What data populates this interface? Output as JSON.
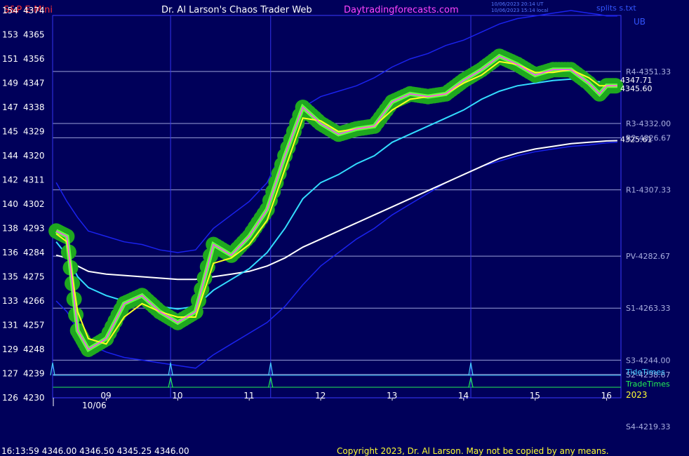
{
  "header": {
    "symbol": "S&P E-Mini",
    "title": "Dr. Al Larson's Chaos Trader Web",
    "site": "Daytradingforecasts.com",
    "timestamp_utc": "10/06/2023 20:14 UT",
    "timestamp_local": "10/06/2023 15:14 local",
    "split": "splits s.txt",
    "ub": "UB"
  },
  "footer": {
    "last_bar": "16:13:59  4346.00 4346.50 4345.25 4346.00",
    "copyright": "Copyright 2023, Dr. Al Larson. May not be copied by any means."
  },
  "colors": {
    "background": "#00005a",
    "frame": "#3a3aff",
    "price_cloud": "#1fa81f",
    "price_core": "#66ff44",
    "yellow_avg": "#ffff22",
    "magenta_avg": "#ff44ff",
    "cyan_avg": "#33ddff",
    "white_avg": "#ffffff",
    "band": "#1a22ee",
    "pivot_line": "#9aa0d8",
    "tide_spike": "#44ccff",
    "trade_spike": "#22ee55",
    "symbol_red": "#ff3333",
    "site_magenta": "#ff44ff"
  },
  "chart_data": {
    "type": "line",
    "date_label": "10/06",
    "year_label": "2023",
    "x_hours": [
      "09",
      "10",
      "11",
      "12",
      "13",
      "14",
      "15",
      "16"
    ],
    "y_axis": {
      "range": [
        4230,
        4374
      ],
      "levels": [
        {
          "pts": "154",
          "price": "4374"
        },
        {
          "pts": "153",
          "price": "4365"
        },
        {
          "pts": "151",
          "price": "4356"
        },
        {
          "pts": "149",
          "price": "4347"
        },
        {
          "pts": "147",
          "price": "4338"
        },
        {
          "pts": "145",
          "price": "4329"
        },
        {
          "pts": "144",
          "price": "4320"
        },
        {
          "pts": "142",
          "price": "4311"
        },
        {
          "pts": "140",
          "price": "4302"
        },
        {
          "pts": "138",
          "price": "4293"
        },
        {
          "pts": "136",
          "price": "4284"
        },
        {
          "pts": "135",
          "price": "4275"
        },
        {
          "pts": "133",
          "price": "4266"
        },
        {
          "pts": "131",
          "price": "4257"
        },
        {
          "pts": "129",
          "price": "4248"
        },
        {
          "pts": "127",
          "price": "4239"
        },
        {
          "pts": "126",
          "price": "4230"
        }
      ]
    },
    "pivots": [
      {
        "label": "R4-4351.33",
        "value": 4351.33
      },
      {
        "label": "R3-4332.00",
        "value": 4332.0
      },
      {
        "label": "R2-4326.67",
        "value": 4326.67
      },
      {
        "label": "R1-4307.33",
        "value": 4307.33
      },
      {
        "label": "PV-4282.67",
        "value": 4282.67
      },
      {
        "label": "S1-4263.33",
        "value": 4263.33
      },
      {
        "label": "S3-4244.00",
        "value": 4244.0
      },
      {
        "label": "S2-4238.67",
        "value": 4238.67
      },
      {
        "label": "S4-4219.33",
        "value": 4219.33
      }
    ],
    "right_values": [
      {
        "label": "4347.71",
        "value": 4347.71
      },
      {
        "label": "4345.60",
        "value": 4345.6
      },
      {
        "label": "4325.61",
        "value": 4325.61
      }
    ],
    "series_time_hours": [
      8.3,
      8.45,
      8.6,
      8.75,
      9.0,
      9.25,
      9.5,
      9.75,
      10.0,
      10.25,
      10.5,
      10.75,
      11.0,
      11.25,
      11.5,
      11.75,
      12.0,
      12.25,
      12.5,
      12.75,
      13.0,
      13.25,
      13.5,
      13.75,
      14.0,
      14.25,
      14.5,
      14.75,
      15.0,
      15.25,
      15.5,
      15.75,
      15.9,
      16.0,
      16.15
    ],
    "series": [
      {
        "name": "price",
        "values": [
          4292,
          4290,
          4255,
          4248,
          4252,
          4265,
          4268,
          4262,
          4258,
          4262,
          4287,
          4283,
          4290,
          4300,
          4320,
          4338,
          4332,
          4328,
          4330,
          4331,
          4340,
          4343,
          4342,
          4343,
          4348,
          4352,
          4357,
          4354,
          4350,
          4352,
          4352,
          4347,
          4343,
          4346,
          4346
        ]
      },
      {
        "name": "yellow",
        "values": [
          4291,
          4288,
          4262,
          4252,
          4250,
          4260,
          4265,
          4262,
          4260,
          4260,
          4280,
          4282,
          4287,
          4296,
          4315,
          4334,
          4333,
          4329,
          4330,
          4331,
          4337,
          4341,
          4342,
          4343,
          4347,
          4350,
          4355,
          4354,
          4351,
          4351,
          4352,
          4349,
          4346,
          4346,
          4346
        ]
      },
      {
        "name": "cyan",
        "values": [
          4288,
          4283,
          4275,
          4271,
          4268,
          4266,
          4265,
          4264,
          4263,
          4264,
          4270,
          4274,
          4278,
          4284,
          4293,
          4304,
          4310,
          4313,
          4317,
          4320,
          4325,
          4328,
          4331,
          4334,
          4337,
          4341,
          4344,
          4346,
          4347,
          4348,
          4348.5,
          4348,
          4347.5,
          4347.2,
          4347
        ]
      },
      {
        "name": "white",
        "values": [
          4283,
          4282,
          4279,
          4277,
          4276,
          4275.5,
          4275,
          4274.5,
          4274,
          4274,
          4275,
          4276,
          4277,
          4279,
          4282,
          4286,
          4289,
          4292,
          4295,
          4298,
          4301,
          4304,
          4307,
          4310,
          4313,
          4316,
          4319,
          4321,
          4322.5,
          4323.5,
          4324.5,
          4325,
          4325.3,
          4325.5,
          4325.6
        ]
      },
      {
        "name": "upper_band",
        "values": [
          4310,
          4303,
          4297,
          4292,
          4290,
          4288,
          4287,
          4285,
          4284,
          4285,
          4293,
          4298,
          4303,
          4310,
          4324,
          4338,
          4342,
          4344,
          4346,
          4349,
          4353,
          4356,
          4358,
          4361,
          4363,
          4366,
          4369,
          4371,
          4372,
          4373,
          4374,
          4373,
          4372.5,
          4372,
          4372
        ]
      },
      {
        "name": "lower_band",
        "values": [
          4266,
          4262,
          4255,
          4250,
          4247,
          4245,
          4244,
          4243,
          4242,
          4241,
          4246,
          4250,
          4254,
          4258,
          4264,
          4272,
          4279,
          4284,
          4289,
          4293,
          4298,
          4302,
          4306,
          4310,
          4313,
          4316,
          4318,
          4320,
          4321.5,
          4322.5,
          4323.5,
          4324,
          4324.5,
          4324.8,
          4325
        ]
      }
    ],
    "vertical_time_lines": [
      8.25,
      9.9,
      11.3,
      14.1
    ],
    "tide_times": {
      "label": "TideTimes",
      "hours": [
        8.25,
        9.9,
        11.3,
        14.1
      ]
    },
    "trade_times": {
      "label": "TradeTimes",
      "hours": [
        9.9,
        11.3,
        14.1
      ]
    }
  }
}
